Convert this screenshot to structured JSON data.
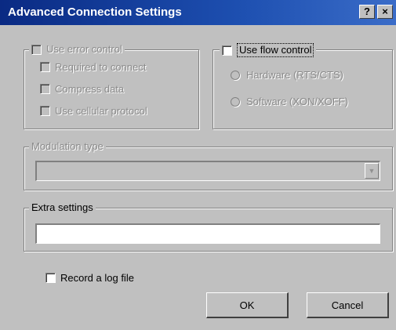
{
  "window": {
    "title": "Advanced Connection Settings",
    "help_button": "?",
    "close_button": "×"
  },
  "error_control": {
    "label": "Use error control",
    "checked": false,
    "enabled": false,
    "options": [
      {
        "label": "Required to connect",
        "checked": false
      },
      {
        "label": "Compress data",
        "checked": false
      },
      {
        "label": "Use cellular protocol",
        "checked": false
      }
    ]
  },
  "flow_control": {
    "label": "Use flow control",
    "checked": false,
    "enabled": true,
    "options": [
      {
        "label": "Hardware (RTS/CTS)",
        "selected": false
      },
      {
        "label": "Software (XON/XOFF)",
        "selected": false
      }
    ]
  },
  "modulation": {
    "label": "Modulation type",
    "value": "",
    "enabled": false
  },
  "extra_settings": {
    "label": "Extra settings",
    "value": ""
  },
  "log_file": {
    "label": "Record a log file",
    "checked": false
  },
  "buttons": {
    "ok": "OK",
    "cancel": "Cancel"
  },
  "colors": {
    "face": "#c0c0c0",
    "title_bar": "#0a2a83",
    "disabled_text": "#8a8a8a"
  }
}
